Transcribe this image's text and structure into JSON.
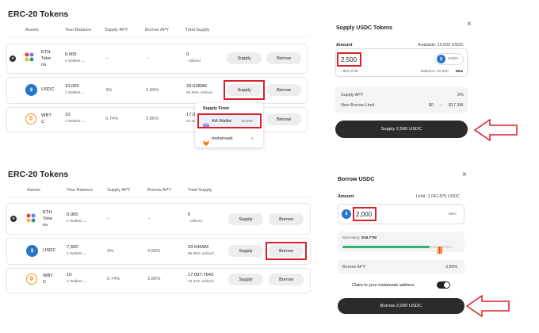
{
  "top": {
    "title": "ERC-20 Tokens",
    "headers": {
      "assets": "Assets",
      "balance": "Your Balance",
      "supply_apy": "Supply APY",
      "borrow_apy": "Borrow APY",
      "total": "Total Supply"
    },
    "rows": [
      {
        "name": "ETH Tokens",
        "name_l1": "ETH",
        "name_l2": "Toke",
        "name_l3": "ns",
        "balance": "0.005",
        "wallets": "2 Wallets",
        "supply_apy": "--",
        "borrow_apy": "--",
        "total": "0",
        "utilized": "- utilized",
        "supply": "Supply",
        "borrow": "Borrow"
      },
      {
        "name": "USDC",
        "balance": "10,000",
        "wallets": "2 Wallets",
        "supply_apy": "3%",
        "borrow_apy": "3.89%",
        "total": "33.6389M",
        "utilized": "85.95% utilized",
        "supply": "Supply",
        "borrow": "Borrow"
      },
      {
        "name_l1": "WBT",
        "name_l2": "C",
        "balance": "10",
        "wallets": "2 Wallets",
        "supply_apy": "0.74%",
        "borrow_apy": "3.86%",
        "total": "17.09",
        "utilized": "24.32",
        "supply": "Supply",
        "borrow": "Borrow"
      }
    ],
    "dropdown": {
      "title": "Supply From",
      "items": [
        {
          "label": "AA Wallet",
          "value": "10,000"
        },
        {
          "label": "metamask",
          "value": "0"
        }
      ]
    }
  },
  "supply_panel": {
    "title": "Supply USDC Tokens",
    "close": "×",
    "amount_label": "Amount",
    "available": "Available: 10,000 USDC",
    "amount": "2,500",
    "token": "USDC",
    "usd": "~$20.97M",
    "balance": "Balance: 10,000",
    "max": "Max",
    "supply_apy_label": "Supply APY",
    "supply_apy": "3%",
    "borrow_limit_label": "New Borrow Limit",
    "borrow_limit_from": "$0",
    "borrow_limit_to": "$17.3M",
    "button": "Supply 2,500 USDC"
  },
  "bottom": {
    "title": "ERC-20 Tokens",
    "headers": {
      "assets": "Assets",
      "balance": "Your Balance",
      "supply_apy": "Supply APY",
      "borrow_apy": "Borrow APY",
      "total": "Total Supply"
    },
    "rows": [
      {
        "name_l1": "ETH",
        "name_l2": "Toke",
        "name_l3": "ns",
        "balance": "0.005",
        "wallets": "2 Wallets",
        "supply_apy": "--",
        "borrow_apy": "--",
        "total": "0",
        "utilized": "- utilized",
        "supply": "Supply",
        "borrow": "Borrow"
      },
      {
        "name": "USDC",
        "balance": "7,500",
        "wallets": "2 Wallets",
        "supply_apy": "3%",
        "borrow_apy": "3.89%",
        "total": "33.6469M",
        "utilized": "85.95% utilized",
        "supply": "Supply",
        "borrow": "Borrow"
      },
      {
        "name_l1": "WBT",
        "name_l2": "C",
        "balance": "10",
        "wallets": "2 Wallets",
        "supply_apy": "0.74%",
        "borrow_apy": "3.86%",
        "total": "17,097.7643",
        "utilized": "24.32% utilized",
        "supply": "Supply",
        "borrow": "Borrow"
      }
    ]
  },
  "borrow_panel": {
    "title": "Borrow USDC",
    "close": "×",
    "amount_label": "Amount",
    "limit": "Limit: 2,041.875 USDC",
    "amount": "2,000",
    "percent": "50%",
    "borrowing_label": "Borrowing:",
    "borrowing_value": "$16.77M",
    "borrowing_fraction": 0.8,
    "borrow_apy_label": "Borrow APY",
    "borrow_apy": "3.89%",
    "claim_label": "Claim to your metamask address",
    "claim_on": true,
    "button": "Borrow 2,000 USDC"
  },
  "colors": {
    "accent": "#d9202a",
    "dark": "#2b2b2b",
    "usdc": "#2775ca",
    "btc": "#f7931a",
    "green": "#2db36f"
  }
}
